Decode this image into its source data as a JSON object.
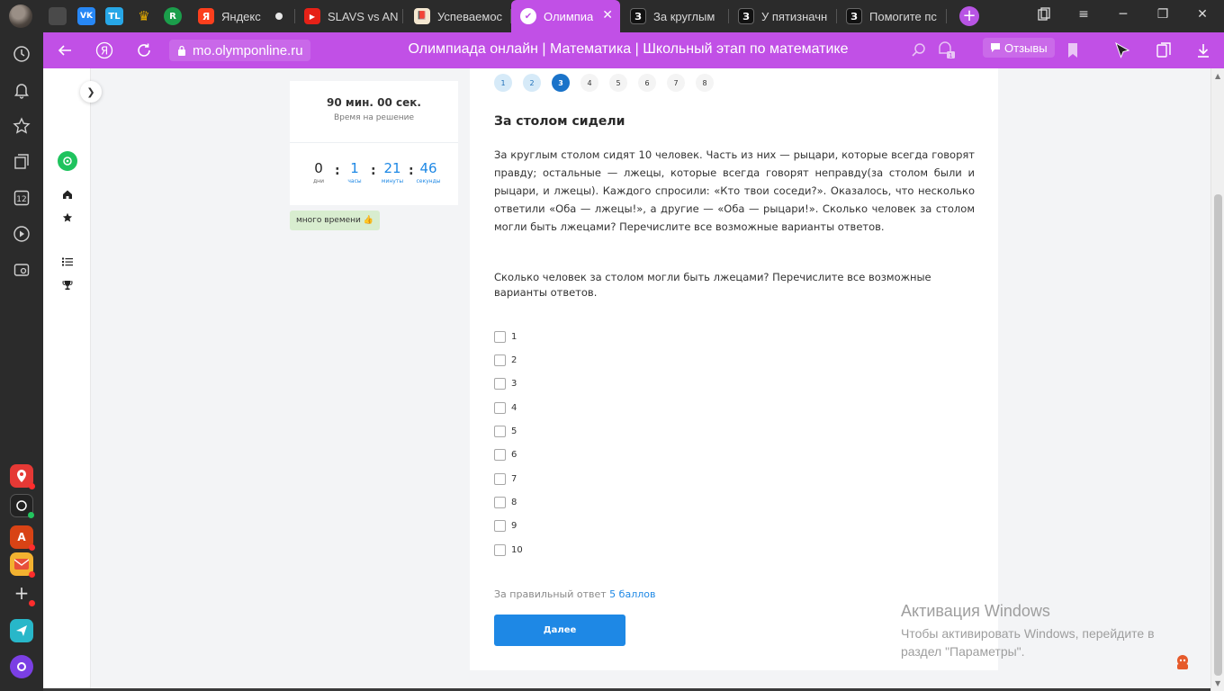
{
  "tabs": [
    {
      "label": ""
    },
    {
      "label": "Яндекс"
    },
    {
      "label": "SLAVS vs AN"
    },
    {
      "label": "Успеваемос"
    },
    {
      "label": "Олимпиа"
    },
    {
      "label": "За круглым"
    },
    {
      "label": "У пятизначн"
    },
    {
      "label": "Помогите пс"
    }
  ],
  "pinned": [
    {
      "text": "",
      "color": "#4a4a4a"
    },
    {
      "text": "VK",
      "color": "#2787f5"
    },
    {
      "text": "TL",
      "color": "#27a7e7"
    },
    {
      "text": "♛",
      "color": "#b8860b"
    },
    {
      "text": "R",
      "color": "#1b9e4b"
    }
  ],
  "address": {
    "url": "mo.olymponline.ru",
    "page_title": "Олимпиада онлайн | Математика | Школьный этап по математике",
    "reviews_label": "Отзывы",
    "badge_count": "1"
  },
  "sidebar_apps": [
    {
      "name": "maps",
      "color": "#e53935"
    },
    {
      "name": "alice",
      "color": "#222222"
    },
    {
      "name": "translate",
      "color": "#d84315"
    },
    {
      "name": "mail",
      "color": "#f2b230"
    }
  ],
  "timer": {
    "total": "90 мин. 00 сек.",
    "total_label": "Время на решение",
    "days": "0",
    "days_label": "дни",
    "hours": "1",
    "hours_label": "часы",
    "minutes": "21",
    "minutes_label": "минуты",
    "seconds": "46",
    "seconds_label": "секунды",
    "badge": "много времени 👍"
  },
  "question_nav": [
    {
      "label": "1",
      "state": "done"
    },
    {
      "label": "2",
      "state": "done"
    },
    {
      "label": "3",
      "state": "current"
    },
    {
      "label": "4",
      "state": "todo"
    },
    {
      "label": "5",
      "state": "todo"
    },
    {
      "label": "6",
      "state": "todo"
    },
    {
      "label": "7",
      "state": "todo"
    },
    {
      "label": "8",
      "state": "todo"
    }
  ],
  "question": {
    "title": "За столом сидели",
    "text": "За круглым столом сидят 10 человек. Часть из них — рыцари, которые всегда говорят правду; остальные — лжецы, которые всегда говорят неправду(за столом были и рыцари, и лжецы). Каждого спросили: «Кто твои соседи?». Оказалось, что несколько ответили «Оба — лжецы!», а другие — «Оба — рыцари!». Сколько человек за столом могли быть лжецами? Перечислите все возможные варианты ответов.",
    "ask": "Сколько человек за столом могли быть лжецами? Перечислите все возможные варианты ответов.",
    "options": [
      "1",
      "2",
      "3",
      "4",
      "5",
      "6",
      "7",
      "8",
      "9",
      "10"
    ],
    "points_prefix": "За правильный ответ",
    "points_value": "5 баллов",
    "next_label": "Далее"
  },
  "watermark": {
    "title": "Активация Windows",
    "text": "Чтобы активировать Windows, перейдите в раздел \"Параметры\"."
  }
}
